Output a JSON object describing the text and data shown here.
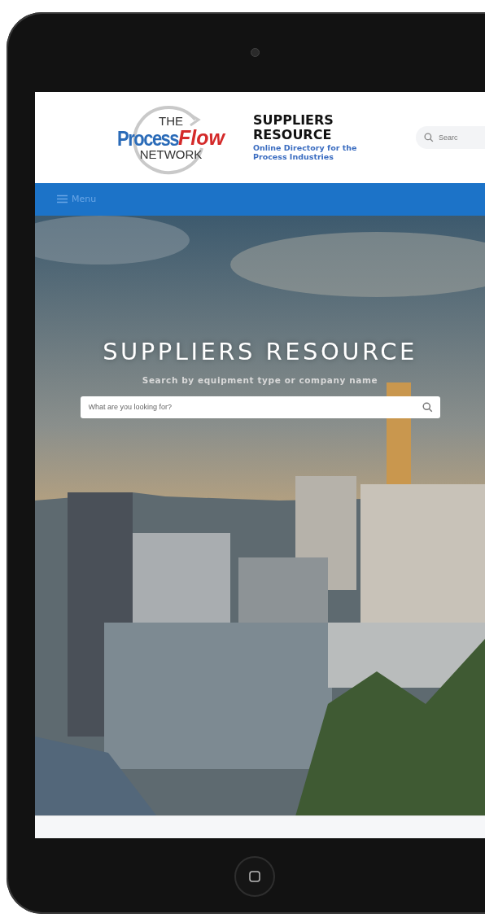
{
  "logo": {
    "top": "THE",
    "word_1": "Process",
    "word_2": "Flow",
    "bottom": "NETWORK"
  },
  "brand": {
    "title": "SUPPLIERS RESOURCE",
    "subtitle": "Online Directory for the Process Industries"
  },
  "header_search": {
    "placeholder": "Searc"
  },
  "nav": {
    "menu_label": "Menu"
  },
  "hero": {
    "kind": "picture",
    "title": "SUPPLIERS RESOURCE",
    "subtitle": "Search by equipment type or company name",
    "search": {
      "placeholder": "What are you looking for?"
    }
  }
}
